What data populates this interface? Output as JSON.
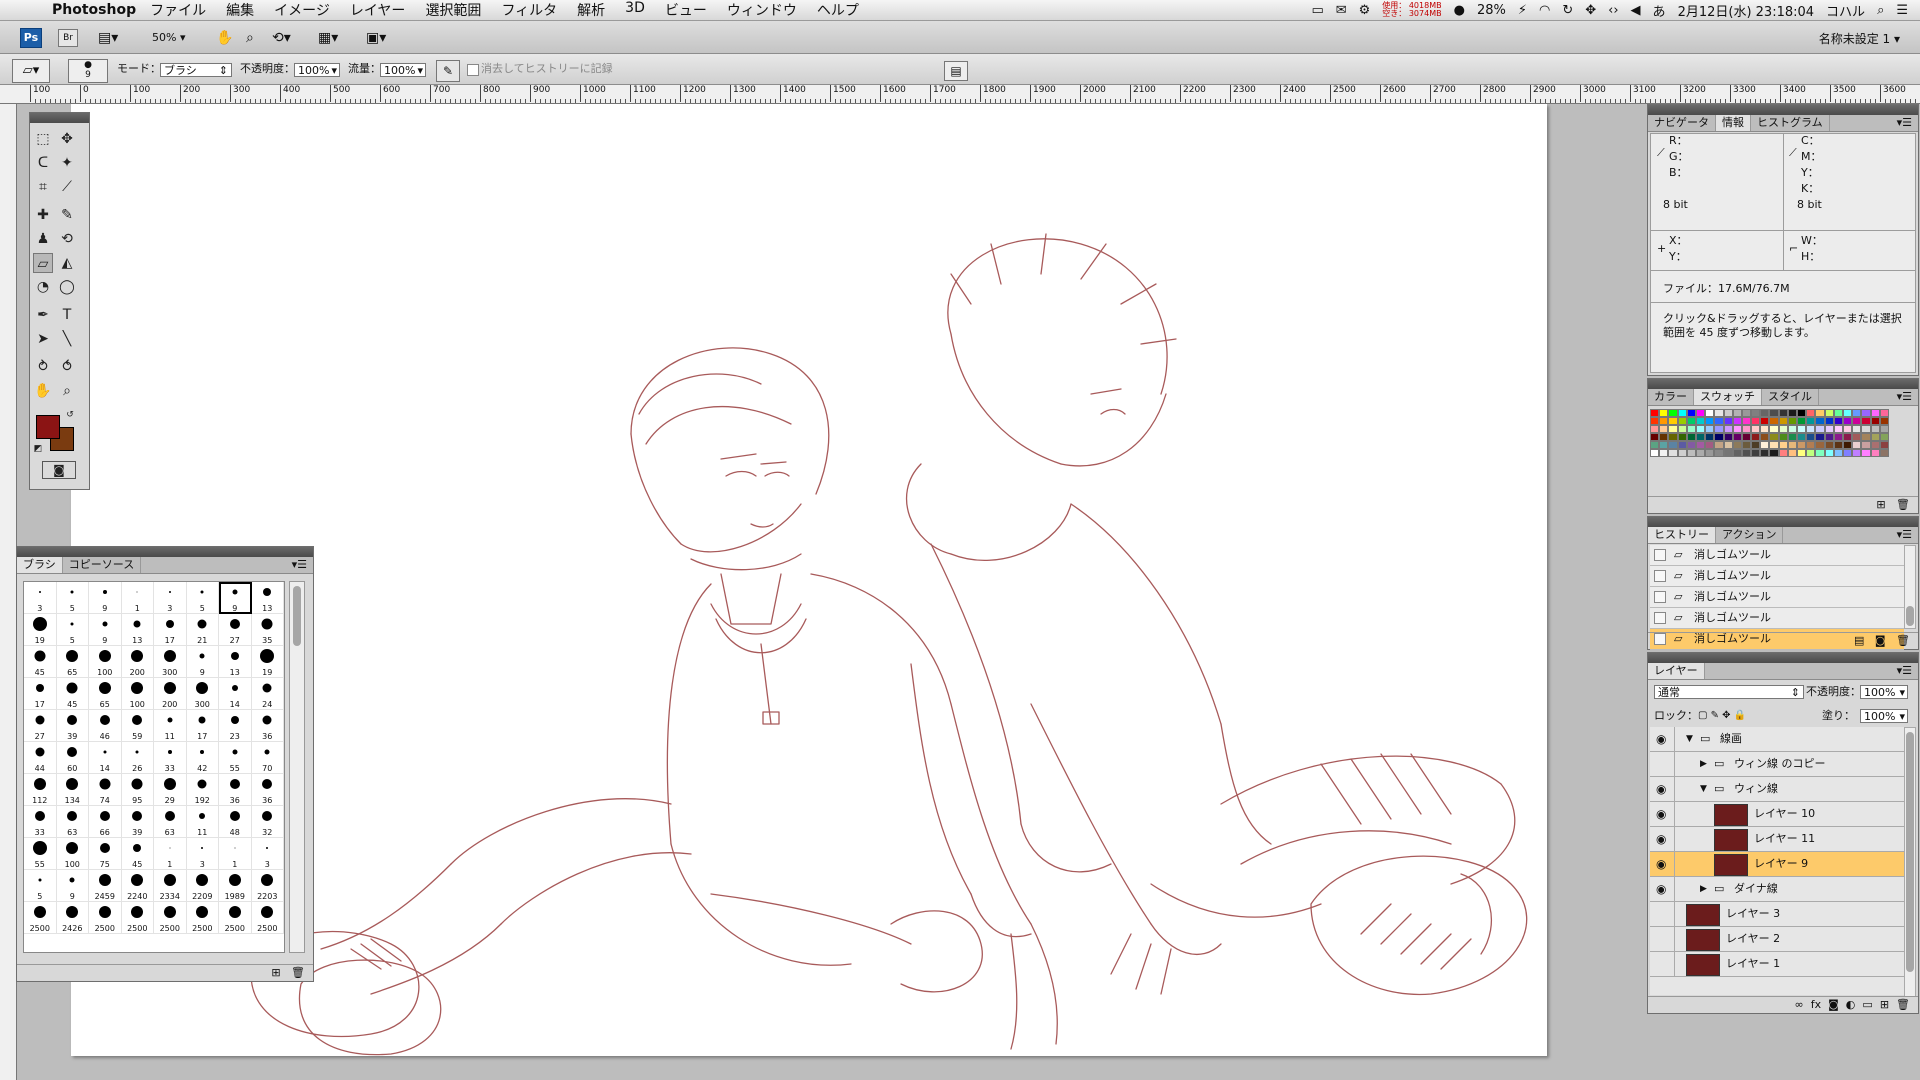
{
  "menubar": {
    "app": "Photoshop",
    "items": [
      "ファイル",
      "編集",
      "イメージ",
      "レイヤー",
      "選択範囲",
      "フィルタ",
      "解析",
      "3D",
      "ビュー",
      "ウィンドウ",
      "ヘルプ"
    ],
    "memory_used": "使用： 4018MB",
    "memory_free": "空き： 3074MB",
    "battery": "28%",
    "date_time": "2月12日(水) 23:18:04",
    "user": "コハル"
  },
  "appbar": {
    "ps_label": "Ps",
    "br_label": "Br",
    "zoom": "50%",
    "workspace": "名称未設定 1"
  },
  "options": {
    "brush_size": "9",
    "mode_label": "モード：",
    "mode_value": "ブラシ",
    "opacity_label": "不透明度：",
    "opacity_value": "100%",
    "flow_label": "流量：",
    "flow_value": "100%",
    "erase_history_label": "消去してヒストリーに記録"
  },
  "ruler": {
    "labels": [
      "100",
      "0",
      "100",
      "200",
      "300",
      "400",
      "500",
      "600",
      "700",
      "800",
      "900",
      "1000",
      "1100",
      "1200",
      "1300",
      "1400",
      "1500",
      "1600",
      "1700",
      "1800",
      "1900",
      "2000",
      "2100",
      "2200",
      "2300",
      "2400",
      "2500",
      "2600",
      "2700",
      "2800",
      "2900",
      "3000",
      "3100",
      "3200",
      "3300",
      "3400",
      "3500",
      "3600"
    ]
  },
  "brushes": {
    "tabs": [
      "ブラシ",
      "コピーソース"
    ],
    "items": [
      {
        "n": "3",
        "s": 2
      },
      {
        "n": "5",
        "s": 3
      },
      {
        "n": "9",
        "s": 4
      },
      {
        "n": "1",
        "s": 1
      },
      {
        "n": "3",
        "s": 2
      },
      {
        "n": "5",
        "s": 3
      },
      {
        "n": "9",
        "s": 5,
        "sel": true
      },
      {
        "n": "13",
        "s": 8
      },
      {
        "n": "19",
        "s": 14
      },
      {
        "n": "5",
        "s": 3
      },
      {
        "n": "9",
        "s": 5
      },
      {
        "n": "13",
        "s": 7
      },
      {
        "n": "17",
        "s": 8
      },
      {
        "n": "21",
        "s": 9
      },
      {
        "n": "27",
        "s": 10
      },
      {
        "n": "35",
        "s": 11
      },
      {
        "n": "45",
        "s": 11
      },
      {
        "n": "65",
        "s": 12
      },
      {
        "n": "100",
        "s": 12
      },
      {
        "n": "200",
        "s": 12
      },
      {
        "n": "300",
        "s": 12
      },
      {
        "n": "9",
        "s": 5
      },
      {
        "n": "13",
        "s": 8
      },
      {
        "n": "19",
        "s": 14
      },
      {
        "n": "17",
        "s": 8
      },
      {
        "n": "45",
        "s": 11
      },
      {
        "n": "65",
        "s": 12
      },
      {
        "n": "100",
        "s": 12
      },
      {
        "n": "200",
        "s": 12
      },
      {
        "n": "300",
        "s": 12
      },
      {
        "n": "14",
        "s": 6
      },
      {
        "n": "24",
        "s": 9
      },
      {
        "n": "27",
        "s": 9
      },
      {
        "n": "39",
        "s": 10
      },
      {
        "n": "46",
        "s": 10
      },
      {
        "n": "59",
        "s": 10
      },
      {
        "n": "11",
        "s": 5
      },
      {
        "n": "17",
        "s": 7
      },
      {
        "n": "23",
        "s": 8
      },
      {
        "n": "36",
        "s": 9
      },
      {
        "n": "44",
        "s": 9
      },
      {
        "n": "60",
        "s": 10
      },
      {
        "n": "14",
        "s": 3
      },
      {
        "n": "26",
        "s": 3
      },
      {
        "n": "33",
        "s": 4
      },
      {
        "n": "42",
        "s": 4
      },
      {
        "n": "55",
        "s": 5
      },
      {
        "n": "70",
        "s": 5
      },
      {
        "n": "112",
        "s": 12
      },
      {
        "n": "134",
        "s": 12
      },
      {
        "n": "74",
        "s": 11
      },
      {
        "n": "95",
        "s": 11
      },
      {
        "n": "29",
        "s": 12
      },
      {
        "n": "192",
        "s": 9
      },
      {
        "n": "36",
        "s": 10
      },
      {
        "n": "36",
        "s": 10
      },
      {
        "n": "33",
        "s": 10
      },
      {
        "n": "63",
        "s": 10
      },
      {
        "n": "66",
        "s": 10
      },
      {
        "n": "39",
        "s": 10
      },
      {
        "n": "63",
        "s": 10
      },
      {
        "n": "11",
        "s": 6
      },
      {
        "n": "48",
        "s": 10
      },
      {
        "n": "32",
        "s": 10
      },
      {
        "n": "55",
        "s": 14
      },
      {
        "n": "100",
        "s": 12
      },
      {
        "n": "75",
        "s": 10
      },
      {
        "n": "45",
        "s": 8
      },
      {
        "n": "1",
        "s": 1
      },
      {
        "n": "3",
        "s": 2
      },
      {
        "n": "1",
        "s": 1
      },
      {
        "n": "3",
        "s": 2
      },
      {
        "n": "5",
        "s": 3
      },
      {
        "n": "9",
        "s": 5
      },
      {
        "n": "2459",
        "s": 12
      },
      {
        "n": "2240",
        "s": 12
      },
      {
        "n": "2334",
        "s": 12
      },
      {
        "n": "2209",
        "s": 12
      },
      {
        "n": "1989",
        "s": 12
      },
      {
        "n": "2203",
        "s": 12
      },
      {
        "n": "2500",
        "s": 12
      },
      {
        "n": "2426",
        "s": 12
      },
      {
        "n": "2500",
        "s": 12
      },
      {
        "n": "2500",
        "s": 12
      },
      {
        "n": "2500",
        "s": 12
      },
      {
        "n": "2500",
        "s": 12
      },
      {
        "n": "2500",
        "s": 12
      },
      {
        "n": "2500",
        "s": 12
      }
    ]
  },
  "info": {
    "tabs": [
      "ナビゲータ",
      "情報",
      "ヒストグラム"
    ],
    "r": "R：",
    "g": "G：",
    "b": "B：",
    "c": "C：",
    "m": "M：",
    "y": "Y：",
    "k": "K：",
    "bit_left": "8 bit",
    "bit_right": "8 bit",
    "x": "X：",
    "yy": "Y：",
    "w": "W：",
    "h": "H：",
    "file": "ファイル：17.6M/76.7M",
    "hint": "クリック&ドラッグすると、レイヤーまたは選択範囲を 45 度ずつ移動します。"
  },
  "swatches": {
    "tabs": [
      "カラー",
      "スウォッチ",
      "スタイル"
    ],
    "colors": [
      "#ff0000",
      "#ffff00",
      "#00ff00",
      "#00ffff",
      "#0000ff",
      "#ff00ff",
      "#ffffff",
      "#e6e6e6",
      "#cccccc",
      "#b3b3b3",
      "#999999",
      "#808080",
      "#666666",
      "#4d4d4d",
      "#333333",
      "#1a1a1a",
      "#000000",
      "#ff6666",
      "#ffcc66",
      "#ccff66",
      "#66ff99",
      "#66ffff",
      "#6699ff",
      "#9966ff",
      "#ff66ff",
      "#ff6699",
      "#ff3300",
      "#ff9900",
      "#ffcc00",
      "#99cc00",
      "#00cc66",
      "#00cccc",
      "#0099ff",
      "#3366ff",
      "#6633ff",
      "#cc33ff",
      "#ff33cc",
      "#ff3366",
      "#cc0000",
      "#cc6600",
      "#cc9900",
      "#669900",
      "#009933",
      "#009999",
      "#0066cc",
      "#0033cc",
      "#3300cc",
      "#9900cc",
      "#cc0099",
      "#cc0033",
      "#990000",
      "#993300",
      "#ff9999",
      "#ffcc99",
      "#ffff99",
      "#ccff99",
      "#99ffcc",
      "#99ffff",
      "#99ccff",
      "#9999ff",
      "#cc99ff",
      "#ff99ff",
      "#ff99cc",
      "#ffcccc",
      "#ffe5cc",
      "#ffffcc",
      "#e5ffcc",
      "#ccffe5",
      "#ccffff",
      "#cce5ff",
      "#ccccff",
      "#e5ccff",
      "#ffccff",
      "#ffcce5",
      "#e5e5e5",
      "#d9d9d9",
      "#bfbfbf",
      "#a6a6a6",
      "#660000",
      "#663300",
      "#666600",
      "#336600",
      "#006633",
      "#006666",
      "#003366",
      "#000066",
      "#330066",
      "#660066",
      "#660033",
      "#8c1a1a",
      "#8c4d1a",
      "#8c8c1a",
      "#4d8c1a",
      "#1a8c4d",
      "#1a8c8c",
      "#1a4d8c",
      "#1a1a8c",
      "#4d1a8c",
      "#8c1a8c",
      "#8c1a4d",
      "#a35b5b",
      "#a3835b",
      "#a3a35b",
      "#83a35b",
      "#5ba383",
      "#5ba3a3",
      "#5b83a3",
      "#5b5ba3",
      "#835ba3",
      "#a35ba3",
      "#a35b83",
      "#c2a385",
      "#d9c2a3",
      "#8c7a5b",
      "#6b5b3d",
      "#4d3d26",
      "#fff0d9",
      "#ffe0b3",
      "#ffd08c",
      "#e6b87a",
      "#cc9966",
      "#b37d52",
      "#99663d",
      "#7a4d29",
      "#5c3314",
      "#3d1a00",
      "#e8d0d0",
      "#c9a0a0",
      "#aa7070",
      "#8b4040",
      "#ffffff",
      "#f2f2f2",
      "#e0e0e0",
      "#cfcfcf",
      "#bdbdbd",
      "#ababab",
      "#999999",
      "#878787",
      "#757575",
      "#636363",
      "#515151",
      "#3f3f3f",
      "#2d2d2d",
      "#1b1b1b",
      "#ff7f7f",
      "#ffbf7f",
      "#ffff7f",
      "#bfff7f",
      "#7fffbf",
      "#7fffff",
      "#7fbfff",
      "#7f7fff",
      "#bf7fff",
      "#ff7fff",
      "#ff7fbf",
      "#8c7365"
    ]
  },
  "history": {
    "tabs": [
      "ヒストリー",
      "アクション"
    ],
    "items": [
      "消しゴムツール",
      "消しゴムツール",
      "消しゴムツール",
      "消しゴムツール",
      "消しゴムツール"
    ],
    "selected_index": 4
  },
  "layers": {
    "tab": "レイヤー",
    "blend_mode": "通常",
    "opacity_label": "不透明度：",
    "opacity": "100%",
    "lock_label": "ロック：",
    "fill_label": "塗り：",
    "fill": "100%",
    "rows": [
      {
        "name": "線画",
        "type": "group",
        "indent": 0,
        "expanded": true,
        "visible": true
      },
      {
        "name": "ウィン線 のコピー",
        "type": "group",
        "indent": 1,
        "expanded": false,
        "visible": false
      },
      {
        "name": "ウィン線",
        "type": "group",
        "indent": 1,
        "expanded": true,
        "visible": true
      },
      {
        "name": "レイヤー 10",
        "type": "layer",
        "indent": 2,
        "visible": true
      },
      {
        "name": "レイヤー 11",
        "type": "layer",
        "indent": 2,
        "visible": true
      },
      {
        "name": "レイヤー 9",
        "type": "layer",
        "indent": 2,
        "visible": true,
        "selected": true
      },
      {
        "name": "ダイナ線",
        "type": "group",
        "indent": 1,
        "expanded": false,
        "visible": true
      },
      {
        "name": "レイヤー 3",
        "type": "layer",
        "indent": 0,
        "visible": false
      },
      {
        "name": "レイヤー 2",
        "type": "layer",
        "indent": 0,
        "visible": false
      },
      {
        "name": "レイヤー 1",
        "type": "layer",
        "indent": 0,
        "visible": false
      }
    ]
  },
  "colors": {
    "foreground": "#8b1414",
    "background": "#7a3b10",
    "sketch": "#a85a5a",
    "selection": "#fdca6a"
  }
}
